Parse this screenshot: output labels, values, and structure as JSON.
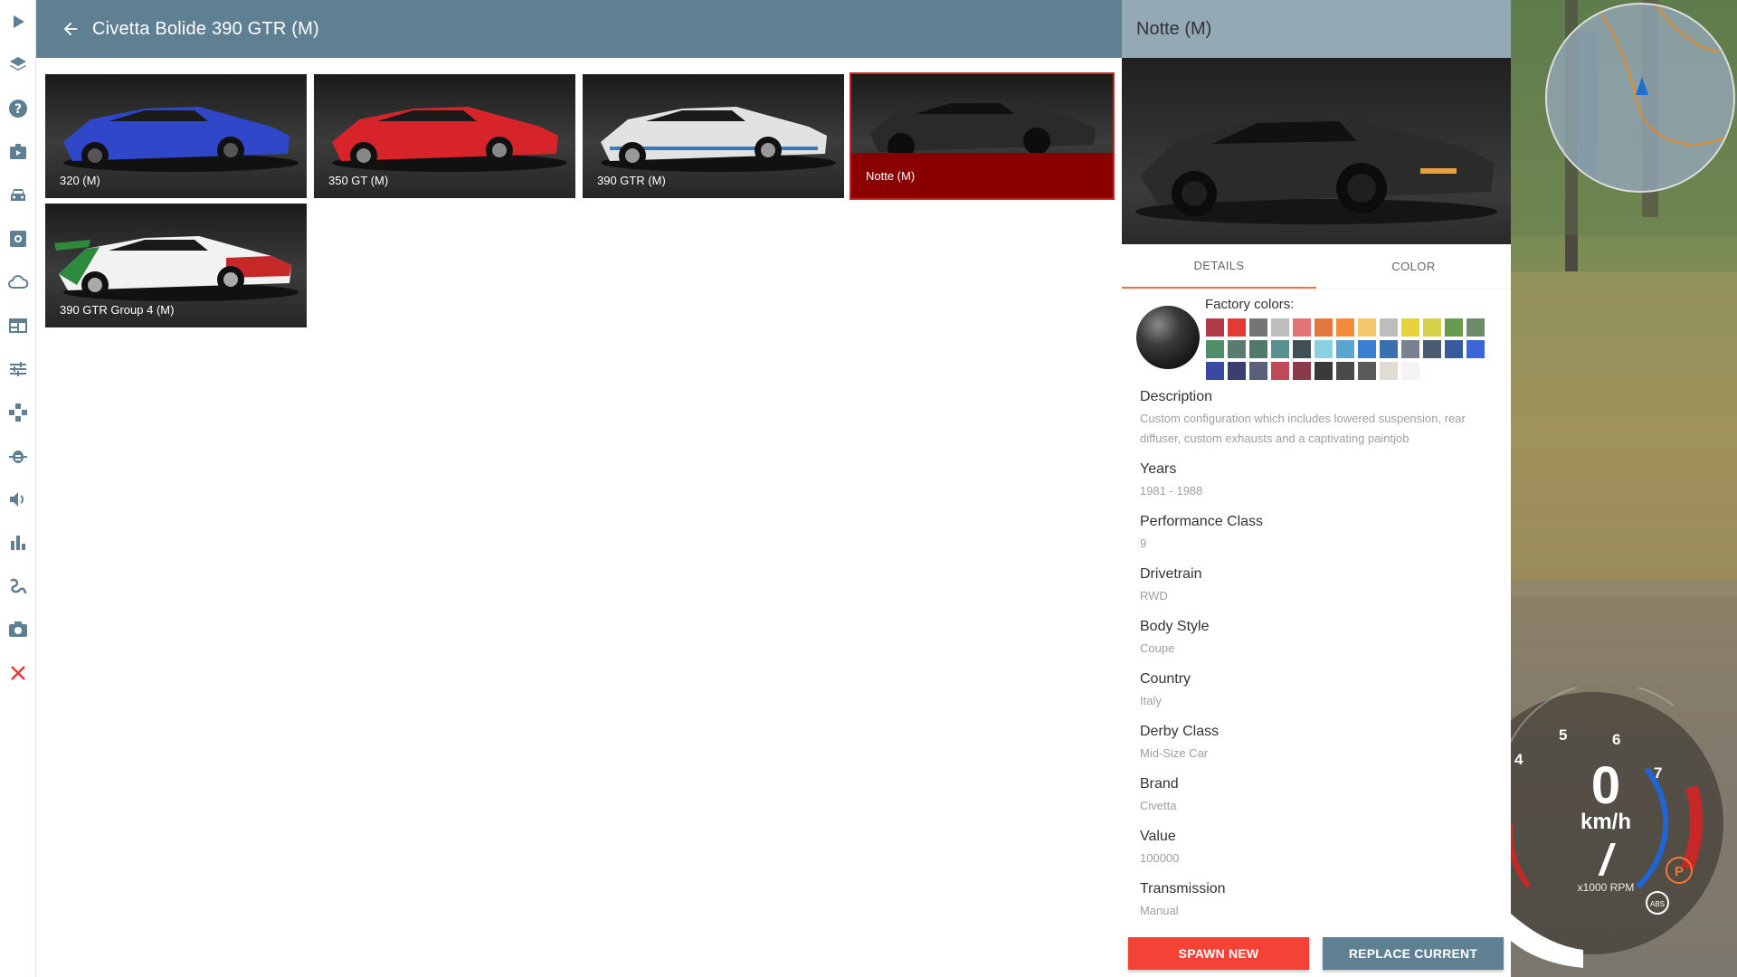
{
  "sidebar": {
    "items": [
      {
        "name": "play-icon"
      },
      {
        "name": "layers-icon"
      },
      {
        "name": "help-icon"
      },
      {
        "name": "mission-icon"
      },
      {
        "name": "vehicle-icon"
      },
      {
        "name": "vehicle-config-icon"
      },
      {
        "name": "environment-cloud-icon"
      },
      {
        "name": "ui-apps-icon"
      },
      {
        "name": "options-sliders-icon"
      },
      {
        "name": "controls-gamepad-icon"
      },
      {
        "name": "debug-bug-icon"
      },
      {
        "name": "audio-icon"
      },
      {
        "name": "performance-chart-icon"
      },
      {
        "name": "track-builder-icon"
      },
      {
        "name": "camera-icon"
      },
      {
        "name": "close-icon"
      }
    ]
  },
  "header": {
    "title": "Civetta Bolide 390 GTR (M)"
  },
  "configs": [
    {
      "label": "320 (M)",
      "color": "#2f47c8",
      "selected": false
    },
    {
      "label": "350 GT (M)",
      "color": "#d6242a",
      "selected": false
    },
    {
      "label": "390 GTR (M)",
      "color": "#e2e2e2",
      "selected": false
    },
    {
      "label": "Notte (M)",
      "color": "#2a2a2a",
      "selected": true
    },
    {
      "label": "390 GTR Group 4 (M)",
      "color": "#f2f2f2",
      "selected": false
    }
  ],
  "detail": {
    "title": "Notte (M)",
    "tabs": [
      "DETAILS",
      "COLOR"
    ],
    "factory_colors_label": "Factory colors:",
    "swatches": [
      "#b23a48",
      "#e53935",
      "#757575",
      "#bdbdbd",
      "#e57373",
      "#e2773d",
      "#f58a3a",
      "#f6c66b",
      "#bdbdbd",
      "#e6d23a",
      "#d4d24a",
      "#6a9a4e",
      "#6f8a6a",
      "#4e8f6a",
      "#5a7a72",
      "#4f7a6a",
      "#5a8f8f",
      "#3f4f55",
      "#8ad0e0",
      "#5aa6d0",
      "#3a7fd0",
      "#3a6fb0",
      "#7a8290",
      "#4a5a70",
      "#3a5aa0",
      "#3a66d8",
      "#3a4aa0",
      "#3a3f70",
      "#5a5f7a",
      "#c04a5a",
      "#8a3a4a",
      "#3a3a3a",
      "#4a4a4a",
      "#5a5a5a",
      "#e0dcd4",
      "#f4f4f4"
    ],
    "info": [
      {
        "key": "Description",
        "value": "Custom configuration which includes lowered suspension, rear diffuser, custom exhausts and a captivating paintjob"
      },
      {
        "key": "Years",
        "value": "1981 - 1988"
      },
      {
        "key": "Performance Class",
        "value": "9"
      },
      {
        "key": "Drivetrain",
        "value": "RWD"
      },
      {
        "key": "Body Style",
        "value": "Coupe"
      },
      {
        "key": "Country",
        "value": "Italy"
      },
      {
        "key": "Derby Class",
        "value": "Mid-Size Car"
      },
      {
        "key": "Brand",
        "value": "Civetta"
      },
      {
        "key": "Value",
        "value": "100000"
      },
      {
        "key": "Transmission",
        "value": "Manual"
      }
    ],
    "spawn_label": "SPAWN NEW",
    "replace_label": "REPLACE CURRENT"
  },
  "hud": {
    "speed": "0",
    "unit": "km/h",
    "gear": "/",
    "rpm_label": "x1000 RPM",
    "ticks": [
      "4",
      "5",
      "6",
      "7"
    ]
  }
}
